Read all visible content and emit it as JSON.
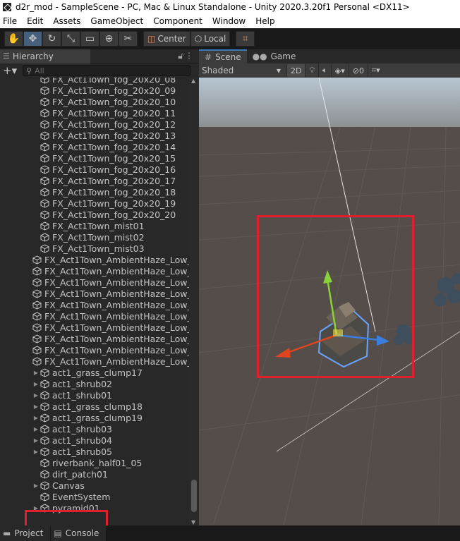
{
  "window": {
    "title": "d2r_mod - SampleScene - PC, Mac & Linux Standalone - Unity 2020.3.20f1 Personal <DX11>"
  },
  "menu": [
    "File",
    "Edit",
    "Assets",
    "GameObject",
    "Component",
    "Window",
    "Help"
  ],
  "toolbar": {
    "tools": [
      {
        "name": "hand-tool-icon",
        "glyph": "✋"
      },
      {
        "name": "move-tool-icon",
        "glyph": "✥"
      },
      {
        "name": "rotate-tool-icon",
        "glyph": "↻"
      },
      {
        "name": "scale-tool-icon",
        "glyph": "⤡"
      },
      {
        "name": "rect-tool-icon",
        "glyph": "▭"
      },
      {
        "name": "transform-tool-icon",
        "glyph": "⊕"
      },
      {
        "name": "custom-tool-icon",
        "glyph": "✂"
      }
    ],
    "pivot": "Center",
    "space": "Local",
    "snap_glyph": "⌗"
  },
  "hierarchy": {
    "tab_label": "Hierarchy",
    "search_placeholder": "All",
    "items": [
      {
        "label": "FX_Act1Town_fog_20x20_08",
        "expandable": false
      },
      {
        "label": "FX_Act1Town_fog_20x20_09",
        "expandable": false
      },
      {
        "label": "FX_Act1Town_fog_20x20_10",
        "expandable": false
      },
      {
        "label": "FX_Act1Town_fog_20x20_11",
        "expandable": false
      },
      {
        "label": "FX_Act1Town_fog_20x20_12",
        "expandable": false
      },
      {
        "label": "FX_Act1Town_fog_20x20_13",
        "expandable": false
      },
      {
        "label": "FX_Act1Town_fog_20x20_14",
        "expandable": false
      },
      {
        "label": "FX_Act1Town_fog_20x20_15",
        "expandable": false
      },
      {
        "label": "FX_Act1Town_fog_20x20_16",
        "expandable": false
      },
      {
        "label": "FX_Act1Town_fog_20x20_17",
        "expandable": false
      },
      {
        "label": "FX_Act1Town_fog_20x20_18",
        "expandable": false
      },
      {
        "label": "FX_Act1Town_fog_20x20_19",
        "expandable": false
      },
      {
        "label": "FX_Act1Town_fog_20x20_20",
        "expandable": false
      },
      {
        "label": "FX_Act1Town_mist01",
        "expandable": false
      },
      {
        "label": "FX_Act1Town_mist02",
        "expandable": false
      },
      {
        "label": "FX_Act1Town_mist03",
        "expandable": false
      },
      {
        "label": "FX_Act1Town_AmbientHaze_Low_",
        "expandable": false
      },
      {
        "label": "FX_Act1Town_AmbientHaze_Low_",
        "expandable": false
      },
      {
        "label": "FX_Act1Town_AmbientHaze_Low_",
        "expandable": false
      },
      {
        "label": "FX_Act1Town_AmbientHaze_Low_",
        "expandable": false
      },
      {
        "label": "FX_Act1Town_AmbientHaze_Low_",
        "expandable": false
      },
      {
        "label": "FX_Act1Town_AmbientHaze_Low_",
        "expandable": false
      },
      {
        "label": "FX_Act1Town_AmbientHaze_Low_",
        "expandable": false
      },
      {
        "label": "FX_Act1Town_AmbientHaze_Low_",
        "expandable": false
      },
      {
        "label": "FX_Act1Town_AmbientHaze_Low_",
        "expandable": false
      },
      {
        "label": "FX_Act1Town_AmbientHaze_Low_",
        "expandable": false
      },
      {
        "label": "act1_grass_clump17",
        "expandable": true
      },
      {
        "label": "act1_shrub02",
        "expandable": true
      },
      {
        "label": "act1_shrub01",
        "expandable": true
      },
      {
        "label": "act1_grass_clump18",
        "expandable": true
      },
      {
        "label": "act1_grass_clump19",
        "expandable": true
      },
      {
        "label": "act1_shrub03",
        "expandable": true
      },
      {
        "label": "act1_shrub04",
        "expandable": true
      },
      {
        "label": "act1_shrub05",
        "expandable": true
      },
      {
        "label": "riverbank_half01_05",
        "expandable": false
      },
      {
        "label": "dirt_patch01",
        "expandable": false
      },
      {
        "label": "Canvas",
        "expandable": true
      },
      {
        "label": "EventSystem",
        "expandable": false
      },
      {
        "label": "pyramid01",
        "expandable": true
      }
    ]
  },
  "scene": {
    "tabs": [
      {
        "label": "Scene",
        "icon": "#"
      },
      {
        "label": "Game",
        "icon": "●●"
      }
    ],
    "shading_mode": "Shaded",
    "mode_2d": "2D",
    "hidden_count": "0"
  },
  "bottom_tabs": [
    {
      "label": "Project",
      "icon": "▬"
    },
    {
      "label": "Console",
      "icon": "▤"
    }
  ],
  "colors": {
    "highlight": "#e0202c",
    "gizmo_y": "#8bd13a",
    "gizmo_x": "#e0451e",
    "gizmo_z": "#3a7fe0"
  }
}
